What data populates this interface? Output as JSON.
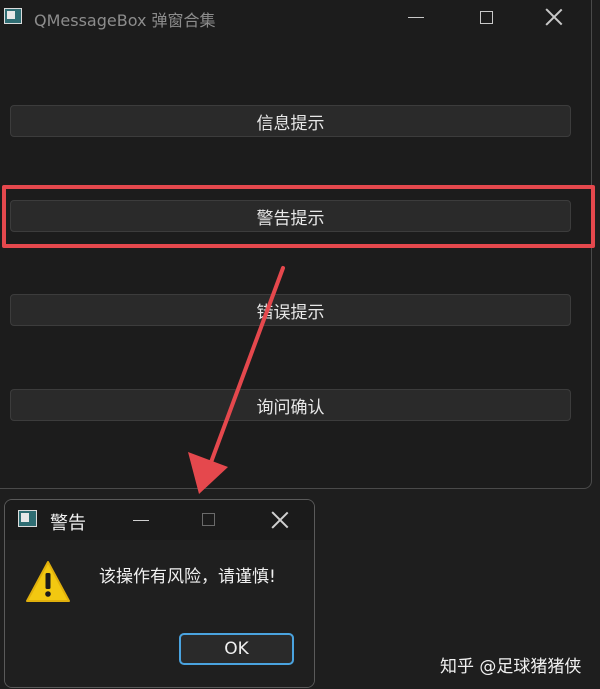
{
  "window": {
    "title": "QMessageBox 弹窗合集"
  },
  "buttons": {
    "info": "信息提示",
    "warning": "警告提示",
    "error": "错误提示",
    "question": "询问确认"
  },
  "dialog": {
    "title": "警告",
    "message": "该操作有风险，请谨慎!",
    "ok_label": "OK"
  },
  "watermark": "知乎 @足球猪猪侠",
  "colors": {
    "highlight": "#e5484d",
    "ok_border": "#4aa3df",
    "warning_icon": "#f2c811"
  }
}
